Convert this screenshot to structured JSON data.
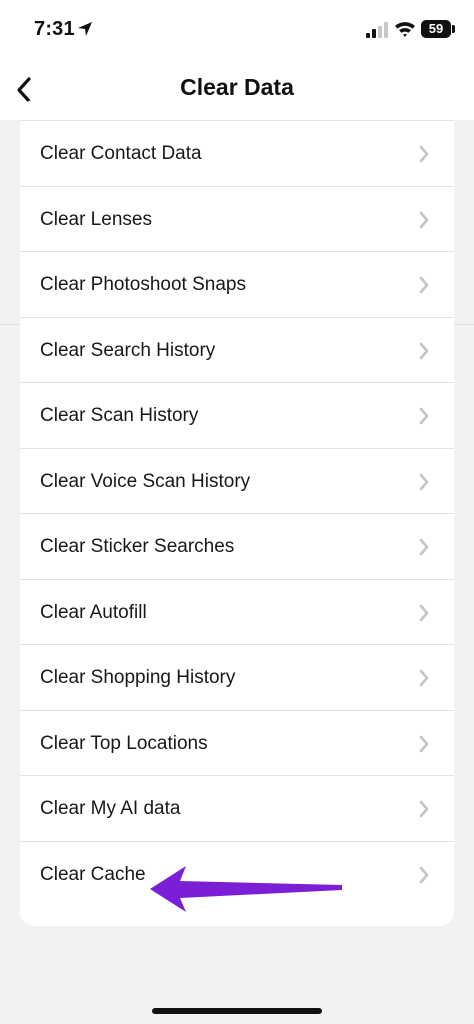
{
  "status": {
    "time": "7:31",
    "battery": "59"
  },
  "nav": {
    "title": "Clear Data"
  },
  "items": [
    {
      "label": "Clear Contact Data"
    },
    {
      "label": "Clear Lenses"
    },
    {
      "label": "Clear Photoshoot Snaps"
    },
    {
      "label": "Clear Search History"
    },
    {
      "label": "Clear Scan History"
    },
    {
      "label": "Clear Voice Scan History"
    },
    {
      "label": "Clear Sticker Searches"
    },
    {
      "label": "Clear Autofill"
    },
    {
      "label": "Clear Shopping History"
    },
    {
      "label": "Clear Top Locations"
    },
    {
      "label": "Clear My AI data"
    },
    {
      "label": "Clear Cache"
    }
  ],
  "colors": {
    "annotation_arrow": "#7a1fd6",
    "chevron": "#c4c4c6"
  }
}
